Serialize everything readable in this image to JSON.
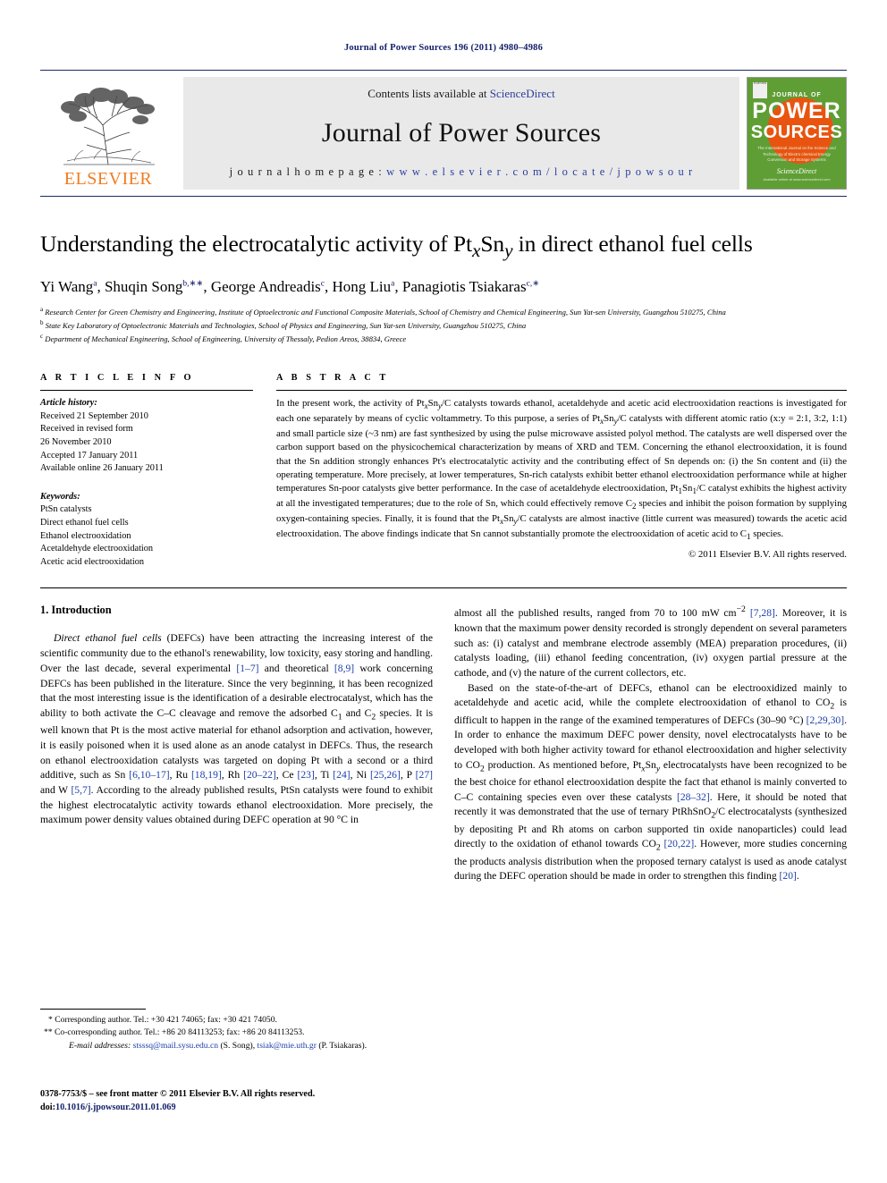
{
  "running_head": "Journal of Power Sources 196 (2011) 4980–4986",
  "masthead": {
    "publisher_wordmark": "ELSEVIER",
    "contents_prefix": "Contents lists available at ",
    "contents_link": "ScienceDirect",
    "journal_name": "Journal of Power Sources",
    "homepage_prefix": "j o u r n a l   h o m e p a g e :   ",
    "homepage_url": "w w w . e l s e v i e r . c o m / l o c a t e / j p o w s o u r",
    "cover": {
      "line1": "JOURNAL OF",
      "line2": "POWER",
      "line3": "SOURCES",
      "subtitle": "The International Journal on the Science and Technology of Electro chemical Energy Conversion and Storage Systems",
      "publisher_mark": "ScienceDirect",
      "publisher_note": "Available online at www.sciencedirect.com",
      "elsevier_box": "ELSEVIER"
    },
    "colors": {
      "rule": "#1b2a66",
      "link": "#2b3f9e",
      "elsevier_orange": "#f07c22",
      "cover_green": "#5f9e34",
      "cover_orange": "#e8540f"
    }
  },
  "article": {
    "title_parts": [
      {
        "t": "Understanding the electrocatalytic activity of Pt"
      },
      {
        "t": "x",
        "style": "sub-ital"
      },
      {
        "t": "Sn"
      },
      {
        "t": "y",
        "style": "sub-ital"
      },
      {
        "t": " in direct ethanol fuel cells"
      }
    ],
    "title_plain": "Understanding the electrocatalytic activity of PtxSny in direct ethanol fuel cells",
    "authors": [
      {
        "name": "Yi Wang",
        "marks": "a"
      },
      {
        "name": "Shuqin Song",
        "marks": "b,∗∗"
      },
      {
        "name": "George Andreadis",
        "marks": "c"
      },
      {
        "name": "Hong Liu",
        "marks": "a"
      },
      {
        "name": "Panagiotis Tsiakaras",
        "marks": "c,∗"
      }
    ],
    "affiliations": [
      {
        "mark": "a",
        "text": "Research Center for Green Chemistry and Engineering, Institute of Optoelectronic and Functional Composite Materials, School of Chemistry and Chemical Engineering, Sun Yat-sen University, Guangzhou 510275, China"
      },
      {
        "mark": "b",
        "text": "State Key Laboratory of Optoelectronic Materials and Technologies, School of Physics and Engineering, Sun Yat-sen University, Guangzhou 510275, China"
      },
      {
        "mark": "c",
        "text": "Department of Mechanical Engineering, School of Engineering, University of Thessaly, Pedion Areos, 38834, Greece"
      }
    ]
  },
  "article_info": {
    "heading": "A R T I C L E  I N F O",
    "history_label": "Article history:",
    "history": [
      "Received 21 September 2010",
      "Received in revised form",
      "26 November 2010",
      "Accepted 17 January 2011",
      "Available online 26 January 2011"
    ],
    "keywords_label": "Keywords:",
    "keywords": [
      "PtSn catalysts",
      "Direct ethanol fuel cells",
      "Ethanol electrooxidation",
      "Acetaldehyde electrooxidation",
      "Acetic acid electrooxidation"
    ]
  },
  "abstract": {
    "heading": "A B S T R A C T",
    "text": "In the present work, the activity of PtxSny/C catalysts towards ethanol, acetaldehyde and acetic acid electrooxidation reactions is investigated for each one separately by means of cyclic voltammetry. To this purpose, a series of PtxSny/C catalysts with different atomic ratio (x:y = 2:1, 3:2, 1:1) and small particle size (~3 nm) are fast synthesized by using the pulse microwave assisted polyol method. The catalysts are well dispersed over the carbon support based on the physicochemical characterization by means of XRD and TEM. Concerning the ethanol electrooxidation, it is found that the Sn addition strongly enhances Pt's electrocatalytic activity and the contributing effect of Sn depends on: (i) the Sn content and (ii) the operating temperature. More precisely, at lower temperatures, Sn-rich catalysts exhibit better ethanol electrooxidation performance while at higher temperatures Sn-poor catalysts give better performance. In the case of acetaldehyde electrooxidation, Pt1Sn1/C catalyst exhibits the highest activity at all the investigated temperatures; due to the role of Sn, which could effectively remove C2 species and inhibit the poison formation by supplying oxygen-containing species. Finally, it is found that the PtxSny/C catalysts are almost inactive (little current was measured) towards the acetic acid electrooxidation. The above findings indicate that Sn cannot substantially promote the electrooxidation of acetic acid to C1 species.",
    "copyright": "© 2011 Elsevier B.V. All rights reserved."
  },
  "body": {
    "section_number_title": "1.  Introduction",
    "left_paragraphs": [
      "Direct ethanol fuel cells (DEFCs) have been attracting the increasing interest of the scientific community due to the ethanol's renewability, low toxicity, easy storing and handling. Over the last decade, several experimental [1–7] and theoretical [8,9] work concerning DEFCs has been published in the literature. Since the very beginning, it has been recognized that the most interesting issue is the identification of a desirable electrocatalyst, which has the ability to both activate the C–C cleavage and remove the adsorbed C1 and C2 species. It is well known that Pt is the most active material for ethanol adsorption and activation, however, it is easily poisoned when it is used alone as an anode catalyst in DEFCs. Thus, the research on ethanol electrooxidation catalysts was targeted on doping Pt with a second or a third additive, such as Sn [6,10–17], Ru [18,19], Rh [20–22], Ce [23], Ti [24], Ni [25,26], P [27] and W [5,7]. According to the already published results, PtSn catalysts were found to exhibit the highest electrocatalytic activity towards ethanol electrooxidation. More precisely, the maximum power density values obtained during DEFC operation at 90 °C in"
    ],
    "right_paragraphs": [
      "almost all the published results, ranged from 70 to 100 mW cm−2 [7,28]. Moreover, it is known that the maximum power density recorded is strongly dependent on several parameters such as: (i) catalyst and membrane electrode assembly (MEA) preparation procedures, (ii) catalysts loading, (iii) ethanol feeding concentration, (iv) oxygen partial pressure at the cathode, and (v) the nature of the current collectors, etc.",
      "Based on the state-of-the-art of DEFCs, ethanol can be electrooxidized mainly to acetaldehyde and acetic acid, while the complete electrooxidation of ethanol to CO2 is difficult to happen in the range of the examined temperatures of DEFCs (30–90 °C) [2,29,30]. In order to enhance the maximum DEFC power density, novel electrocatalysts have to be developed with both higher activity toward for ethanol electrooxidation and higher selectivity to CO2 production. As mentioned before, PtxSny electrocatalysts have been recognized to be the best choice for ethanol electrooxidation despite the fact that ethanol is mainly converted to C–C containing species even over these catalysts [28–32]. Here, it should be noted that recently it was demonstrated that the use of ternary PtRhSnO2/C electrocatalysts (synthesized by depositing Pt and Rh atoms on carbon supported tin oxide nanoparticles) could lead directly to the oxidation of ethanol towards CO2 [20,22]. However, more studies concerning the products analysis distribution when the proposed ternary catalyst is used as anode catalyst during the DEFC operation should be made in order to strengthen this finding [20]."
    ]
  },
  "footnotes": {
    "line1": "* Corresponding author. Tel.: +30 421 74065; fax: +30 421 74050.",
    "line2": "** Co-corresponding author. Tel.: +86 20 84113253; fax: +86 20 84113253.",
    "email_label": "E-mail addresses:",
    "email1": "stsssq@mail.sysu.edu.cn",
    "email1_owner": "(S. Song),",
    "email2": "tsiak@mie.uth.gr",
    "email2_owner": "(P. Tsiakaras)."
  },
  "footer": {
    "issn_line": "0378-7753/$ – see front matter © 2011 Elsevier B.V. All rights reserved.",
    "doi_label": "doi:",
    "doi_value": "10.1016/j.jpowsour.2011.01.069"
  }
}
